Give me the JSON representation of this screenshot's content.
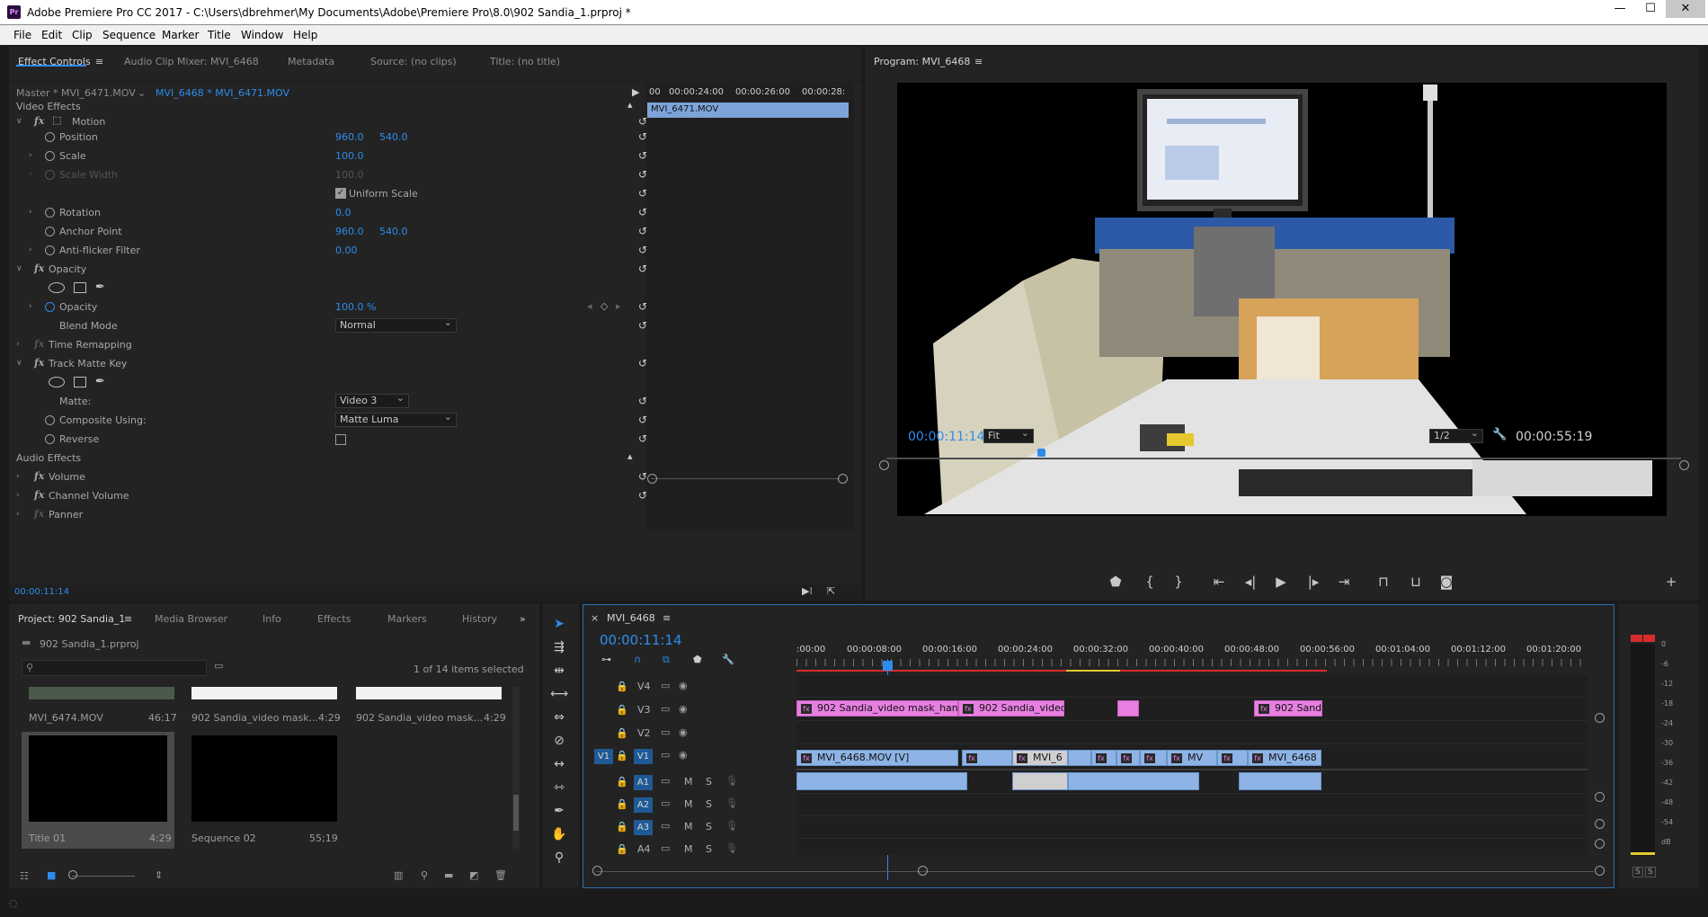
{
  "window": {
    "title": "Adobe Premiere Pro CC 2017 - C:\\Users\\dbrehmer\\My Documents\\Adobe\\Premiere Pro\\8.0\\902 Sandia_1.prproj *",
    "app_icon": "Pr",
    "minimize": "—",
    "maximize": "☐",
    "close": "✕"
  },
  "menu": [
    "File",
    "Edit",
    "Clip",
    "Sequence",
    "Marker",
    "Title",
    "Window",
    "Help"
  ],
  "effect_panel": {
    "tabs": [
      "Effect Controls",
      "Audio Clip Mixer: MVI_6468",
      "Metadata",
      "Source: (no clips)",
      "Title: (no title)"
    ],
    "master": "Master * MVI_6471.MOV",
    "sequence": "MVI_6468 * MVI_6471.MOV",
    "ruler": [
      "00:00:24:00",
      "00:00:26:00",
      "00:00:28:"
    ],
    "ruler_start": "00",
    "clip_name": "MVI_6471.MOV",
    "video_effects": "Video Effects",
    "motion": "Motion",
    "position": {
      "label": "Position",
      "x": "960.0",
      "y": "540.0"
    },
    "scale": {
      "label": "Scale",
      "v": "100.0"
    },
    "scale_width": {
      "label": "Scale Width",
      "v": "100.0"
    },
    "uniform": "Uniform Scale",
    "rotation": {
      "label": "Rotation",
      "v": "0.0"
    },
    "anchor": {
      "label": "Anchor Point",
      "x": "960.0",
      "y": "540.0"
    },
    "antiflicker": {
      "label": "Anti-flicker Filter",
      "v": "0.00"
    },
    "opacity_group": "Opacity",
    "opacity": {
      "label": "Opacity",
      "v": "100.0 %"
    },
    "blend": {
      "label": "Blend Mode",
      "v": "Normal"
    },
    "time_remap": "Time Remapping",
    "track_matte": "Track Matte Key",
    "matte": {
      "label": "Matte:",
      "v": "Video 3"
    },
    "composite": {
      "label": "Composite Using:",
      "v": "Matte Luma"
    },
    "reverse": "Reverse",
    "audio_effects": "Audio Effects",
    "volume": "Volume",
    "channel_volume": "Channel Volume",
    "panner": "Panner",
    "timecode": "00:00:11:14"
  },
  "program": {
    "tab": "Program: MVI_6468",
    "timecode": "00:00:11:14",
    "fit": "Fit",
    "res": "1/2",
    "duration": "00:00:55:19"
  },
  "project": {
    "tabs": [
      "Project: 902 Sandia_1",
      "Media Browser",
      "Info",
      "Effects",
      "Markers",
      "History"
    ],
    "file": "902 Sandia_1.prproj",
    "count": "1 of 14 items selected",
    "items": [
      {
        "name": "MVI_6474.MOV",
        "dur": "46:17"
      },
      {
        "name": "902 Sandia_video mask...",
        "dur": "4:29"
      },
      {
        "name": "902 Sandia_video mask...",
        "dur": "4:29"
      },
      {
        "name": "Title 01",
        "dur": "4:29"
      },
      {
        "name": "Sequence 02",
        "dur": "55;19"
      }
    ]
  },
  "timeline": {
    "tab": "MVI_6468",
    "timecode": "00:00:11:14",
    "ruler": [
      ":00:00",
      "00:00:08:00",
      "00:00:16:00",
      "00:00:24:00",
      "00:00:32:00",
      "00:00:40:00",
      "00:00:48:00",
      "00:00:56:00",
      "00:01:04:00",
      "00:01:12:00",
      "00:01:20:00"
    ],
    "video_tracks": [
      "V4",
      "V3",
      "V2",
      "V1"
    ],
    "audio_tracks": [
      "A1",
      "A2",
      "A3",
      "A4"
    ],
    "src_v": "V1",
    "m": "M",
    "s": "S",
    "clips": {
      "v3a": "902 Sandia_video mask_hand",
      "v3b": "902 Sandia_video",
      "v3c": "902 Sandi",
      "v1a": "MVI_6468.MOV [V]",
      "v1b": "MVI_6",
      "v1c": "MV",
      "v1d": "MVI_6468"
    }
  },
  "meter": {
    "scale": [
      "0",
      "-6",
      "-12",
      "-18",
      "-24",
      "-30",
      "-36",
      "-42",
      "-48",
      "-54",
      "dB"
    ],
    "solo": [
      "S",
      "S"
    ]
  }
}
